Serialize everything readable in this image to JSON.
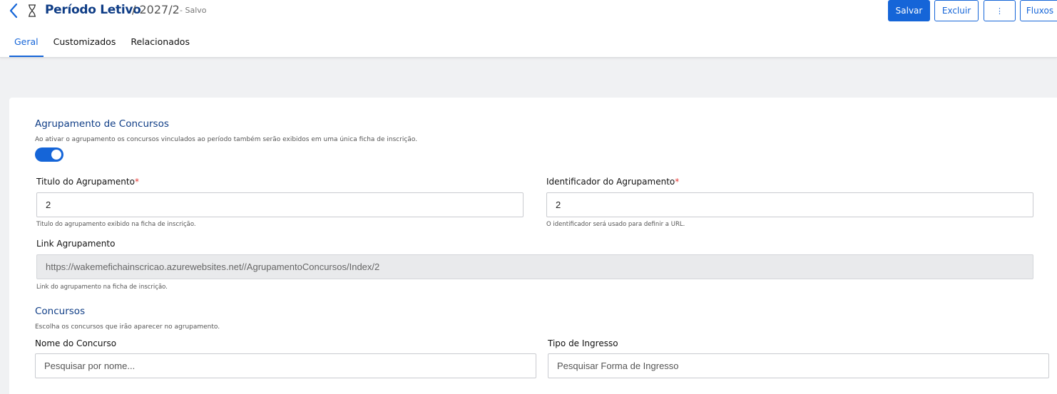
{
  "header": {
    "title": "Período Letivo",
    "subtitle": "/ 2027/2",
    "status": "- Salvo",
    "buttons": {
      "save": "Salvar",
      "delete": "Excluir",
      "more": "⋮",
      "flows": "Fluxos"
    },
    "icons": {
      "back": "chevron-left-icon",
      "type": "hourglass-icon",
      "more": "vertical-ellipsis-icon"
    }
  },
  "tabs": [
    {
      "label": "Geral",
      "active": true
    },
    {
      "label": "Customizados",
      "active": false
    },
    {
      "label": "Relacionados",
      "active": false
    }
  ],
  "grouping": {
    "title": "Agrupamento de Concursos",
    "description": "Ao ativar o agrupamento os concursos vinculados ao período também serão exibidos em uma única ficha de inscrição.",
    "enabled": true,
    "title_field": {
      "label": "Titulo do Agrupamento",
      "required_mark": "*",
      "value": "2",
      "help": "Titulo do agrupamento exibido na ficha de inscrição."
    },
    "identifier_field": {
      "label": "Identificador do Agrupamento",
      "required_mark": "*",
      "value": "2",
      "help": "O identificador será usado para definir a URL."
    },
    "link_field": {
      "label": "Link Agrupamento",
      "value": "https://wakemefichainscricao.azurewebsites.net//AgrupamentoConcursos/Index/2",
      "help": "Link do agrupamento na ficha de inscrição."
    }
  },
  "contests": {
    "title": "Concursos",
    "description": "Escolha os concursos que irão aparecer no agrupamento.",
    "name_field": {
      "label": "Nome do Concurso",
      "placeholder": "Pesquisar por nome..."
    },
    "type_field": {
      "label": "Tipo de Ingresso",
      "placeholder": "Pesquisar Forma de Ingresso"
    }
  },
  "colors": {
    "accent": "#1565d8",
    "title": "#0f3d86",
    "required": "#e53935",
    "background": "#f0f1f3"
  }
}
